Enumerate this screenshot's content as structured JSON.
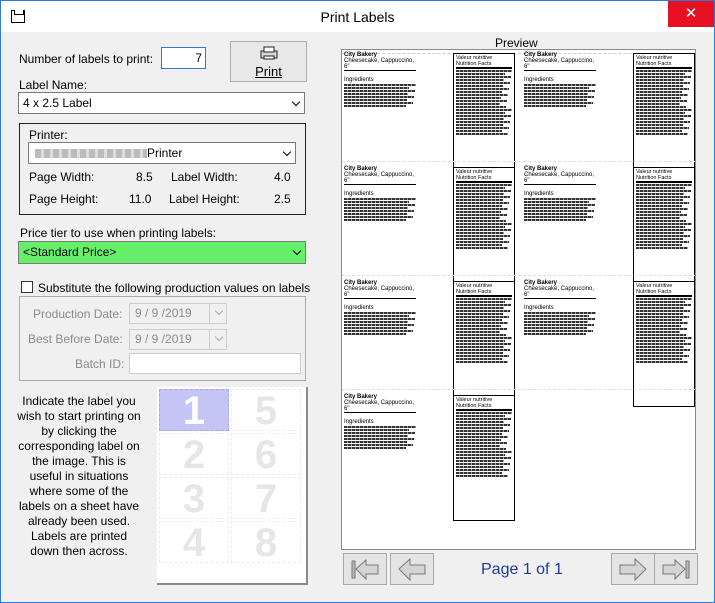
{
  "window": {
    "title": "Print Labels",
    "close_glyph": "✕"
  },
  "form": {
    "num_labels_label": "Number of labels to print:",
    "num_labels_value": "7",
    "print_button": "Print",
    "label_name_label": "Label Name:",
    "label_name_value": "4 x 2.5 Label",
    "printer_label": "Printer:",
    "printer_value": "Printer",
    "page_width_label": "Page Width:",
    "page_width_value": "8.5",
    "label_width_label": "Label Width:",
    "label_width_value": "4.0",
    "page_height_label": "Page Height:",
    "page_height_value": "11.0",
    "label_height_label": "Label Height:",
    "label_height_value": "2.5",
    "price_tier_label": "Price tier to use when printing labels:",
    "price_tier_value": "<Standard Price>",
    "substitute_label": "Substitute the following production values on labels",
    "production_date_label": "Production Date:",
    "production_date_value": "9 / 9 /2019",
    "best_before_label": "Best Before Date:",
    "best_before_value": "9 / 9 /2019",
    "batch_id_label": "Batch ID:",
    "batch_id_value": "",
    "instructions": "Indicate the label you wish to start printing on by clicking the corresponding label on the image. This is useful in situations where some of the labels on a sheet have already been used. Labels are printed down then across."
  },
  "start_grid": [
    "1",
    "2",
    "3",
    "4",
    "5",
    "6",
    "7",
    "8"
  ],
  "preview": {
    "title": "Preview",
    "page_indicator": "Page 1 of 1",
    "label_company": "City Bakery",
    "label_product": "Cheesecake, Cappuccino, 6\"",
    "label_ingredients": "Ingredients",
    "nutrition_fr": "Valeur nutritive",
    "nutrition_en": "Nutrition Facts"
  },
  "colors": {
    "accent": "#2b79d8",
    "price_tier_bg": "#66f06a",
    "selected_cell": "#c5c5f5",
    "close_red": "#e81123"
  }
}
